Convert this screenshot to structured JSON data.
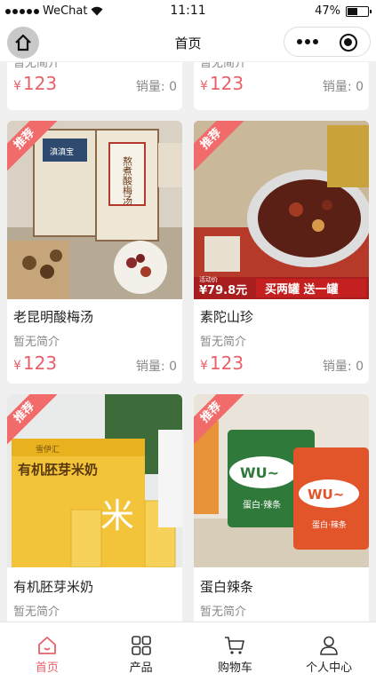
{
  "status_bar": {
    "carrier": "WeChat",
    "time": "11:11",
    "battery": "47%"
  },
  "nav": {
    "title": "首页"
  },
  "cards_top": [
    {
      "desc": "暂无简介",
      "price": "123",
      "currency": "¥",
      "sales_label": "销量:",
      "sales": "0"
    },
    {
      "desc": "暂无简介",
      "price": "123",
      "currency": "¥",
      "sales_label": "销量:",
      "sales": "0"
    }
  ],
  "products": [
    {
      "name": "老昆明酸梅汤",
      "desc": "暂无简介",
      "price": "123",
      "currency": "¥",
      "sales_label": "销量:",
      "sales": "0",
      "badge": "推荐"
    },
    {
      "name": "素陀山珍",
      "desc": "暂无简介",
      "price": "123",
      "currency": "¥",
      "sales_label": "销量:",
      "sales": "0",
      "badge": "推荐",
      "promo_price": "¥79.8元",
      "promo_text": "买两罐 送一罐",
      "promo_small": "活动价"
    },
    {
      "name": "有机胚芽米奶",
      "desc": "暂无简介",
      "badge": "推荐"
    },
    {
      "name": "蛋白辣条",
      "desc": "暂无简介",
      "badge": "推荐"
    }
  ],
  "img_text": {
    "box1": "熬煮酸梅汤",
    "box2": "滇滇宝",
    "milk_title": "有机胚芽米奶",
    "milk_brand": "雪伊汇",
    "milk_char": "米",
    "wu": "WU~",
    "wu_sub1": "蛋白·辣条",
    "wu_sub2": "蛋白·辣条"
  },
  "tabs": [
    {
      "label": "首页",
      "icon": "home-icon",
      "active": true
    },
    {
      "label": "产品",
      "icon": "grid-icon",
      "active": false
    },
    {
      "label": "购物车",
      "icon": "cart-icon",
      "active": false
    },
    {
      "label": "个人中心",
      "icon": "user-icon",
      "active": false
    }
  ],
  "colors": {
    "accent": "#e8606a",
    "ribbon": "#f26b6b"
  }
}
